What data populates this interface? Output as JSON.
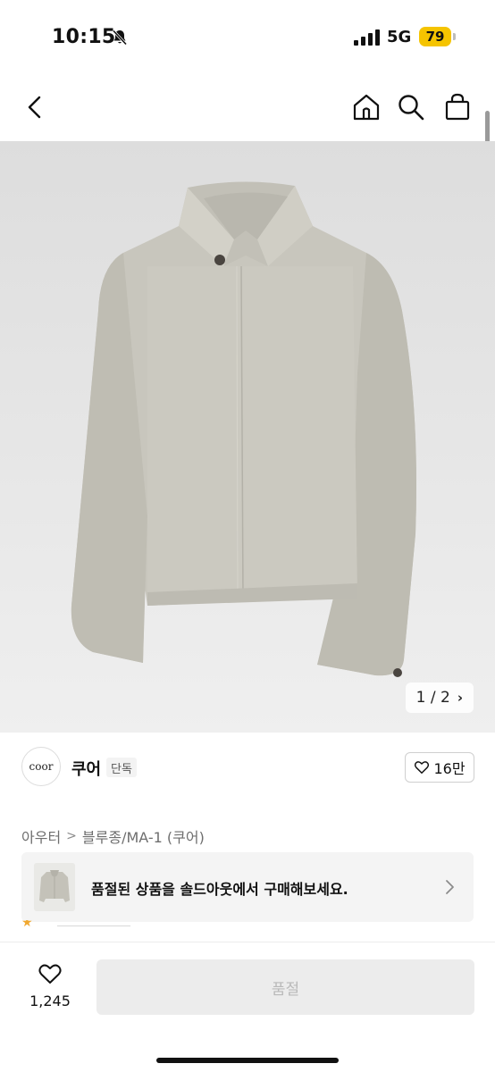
{
  "status_bar": {
    "time": "10:15",
    "network": "5G",
    "battery": "79",
    "icons": [
      "bell-slash-icon",
      "signal-icon"
    ]
  },
  "navbar": {
    "icons": [
      "chevron-left-icon",
      "home-icon",
      "search-icon",
      "shopping-bag-icon"
    ]
  },
  "product_image": {
    "counter_text": "1 / 2",
    "counter_icon": "chevron-right-icon",
    "alt": "light grey cropped jacket"
  },
  "brand": {
    "logo_text": "coor",
    "name": "쿠어",
    "badge": "단독",
    "likes": "16만",
    "likes_icon": "heart-outline-icon"
  },
  "category": {
    "path": [
      "아우터",
      "블루종/MA-1 (쿠어)"
    ],
    "separator": ">"
  },
  "soldout_banner": {
    "text": "품절된 상품을 솔드아웃에서 구매해보세요.",
    "icon": "chevron-right-icon"
  },
  "bottom_bar": {
    "wish_count": "1,245",
    "buy_label": "품절"
  },
  "colors": {
    "accent_battery": "#f5c400",
    "buy_button_bg": "#ececec",
    "buy_button_text": "#b9b9b9"
  }
}
